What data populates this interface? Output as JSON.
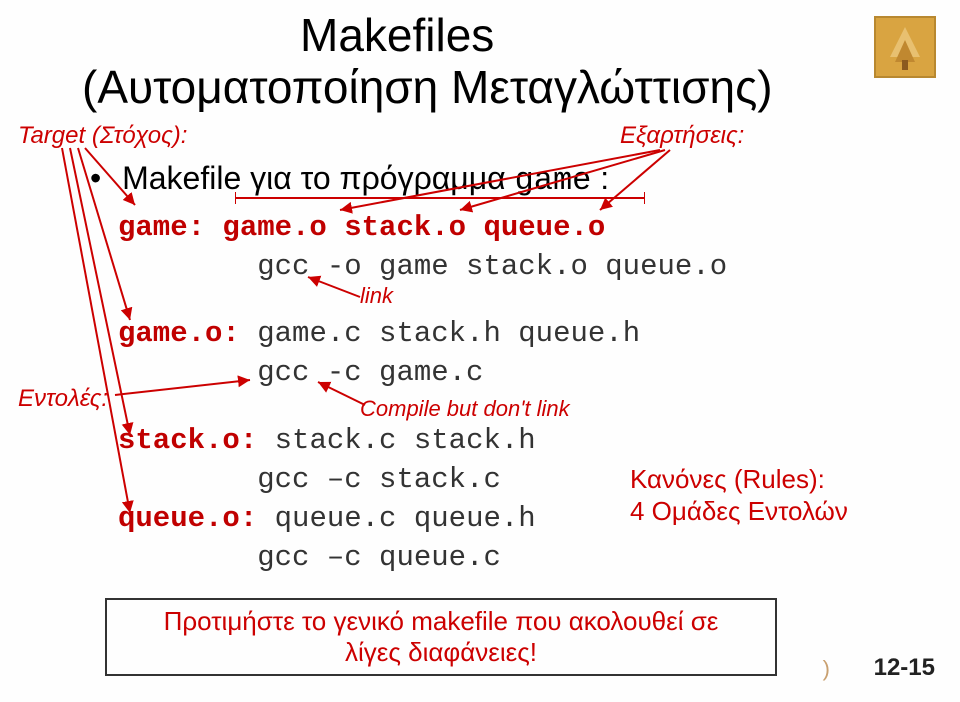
{
  "title": {
    "line1": "Makefiles",
    "line2": "(Αυτοματοποίηση Μεταγλώττισης)"
  },
  "labels": {
    "target": "Target (Στόχος):",
    "deps": "Εξαρτήσεις:",
    "link": "link",
    "commands": "Εντολές:",
    "compile": "Compile  but don't link",
    "rules_title": "Κανόνες (Rules):",
    "rules_sub": "4 Ομάδες Εντολών"
  },
  "bullet": {
    "prefix": "Makefile για το πρόγραμμα ",
    "prog": "game",
    "suffix": " :"
  },
  "code": {
    "l1a": "game:",
    "l1b": " game.o stack.o queue.o",
    "l2": "        gcc -o game stack.o queue.o",
    "l3a": "game.o:",
    "l3b": " game.c stack.h queue.h",
    "l4": "        gcc -c game.c",
    "l5a": "stack.o:",
    "l5b": " stack.c stack.h",
    "l6": "        gcc –c stack.c",
    "l7a": "queue.o:",
    "l7b": " queue.c queue.h",
    "l8": "        gcc –c queue.c"
  },
  "bottom": {
    "line1": "Προτιμήστε το γενικό makefile που ακολουθεί σε",
    "line2": "λίγες διαφάνειες!"
  },
  "page": "12-15",
  "faded": ")"
}
